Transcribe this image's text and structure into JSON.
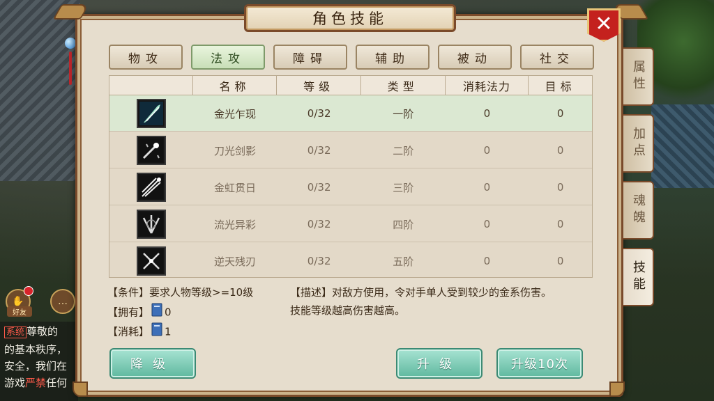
{
  "window": {
    "title": "角色技能",
    "close_icon": "close-x-icon"
  },
  "tabs": [
    {
      "label": "物攻",
      "active": false
    },
    {
      "label": "法攻",
      "active": true
    },
    {
      "label": "障碍",
      "active": false
    },
    {
      "label": "辅助",
      "active": false
    },
    {
      "label": "被动",
      "active": false
    },
    {
      "label": "社交",
      "active": false
    }
  ],
  "side_tabs": [
    {
      "label": "属性",
      "active": false
    },
    {
      "label": "加点",
      "active": false
    },
    {
      "label": "魂魄",
      "active": false
    },
    {
      "label": "技能",
      "active": true
    }
  ],
  "table": {
    "headers": [
      "",
      "名称",
      "等级",
      "类型",
      "消耗法力",
      "目标"
    ],
    "rows": [
      {
        "icon": "jade-blade-icon",
        "name": "金光乍现",
        "level": "0/32",
        "type": "一阶",
        "mana": "0",
        "target": "0",
        "selected": true
      },
      {
        "icon": "sword-sparkle-icon",
        "name": "刀光剑影",
        "level": "0/32",
        "type": "二阶",
        "mana": "0",
        "target": "0",
        "selected": false
      },
      {
        "icon": "sword-burst-icon",
        "name": "金虹贯日",
        "level": "0/32",
        "type": "三阶",
        "mana": "0",
        "target": "0",
        "selected": false
      },
      {
        "icon": "sword-fan-icon",
        "name": "流光异彩",
        "level": "0/32",
        "type": "四阶",
        "mana": "0",
        "target": "0",
        "selected": false
      },
      {
        "icon": "sword-cross-icon",
        "name": "逆天残刃",
        "level": "0/32",
        "type": "五阶",
        "mana": "0",
        "target": "0",
        "selected": false
      }
    ]
  },
  "info": {
    "condition": "【条件】要求人物等级>=10级",
    "own_label": "【拥有】",
    "own_value": "0",
    "cost_label": "【消耗】",
    "cost_value": "1",
    "desc_line1": "【描述】对敌方使用，令对手单人受到较少的金系伤害。",
    "desc_line2": "技能等级越高伤害越高。"
  },
  "buttons": {
    "downgrade": "降级",
    "upgrade": "升级",
    "upgrade10": "升级10次"
  },
  "chat": {
    "friend_label": "好友",
    "sys_tag": "系统",
    "line1": "尊敬的",
    "line2": "的基本秩序，",
    "line3": "安全，我们在",
    "line4_pre": "游戏",
    "line4_red": "严禁",
    "line4_post": "任何"
  }
}
